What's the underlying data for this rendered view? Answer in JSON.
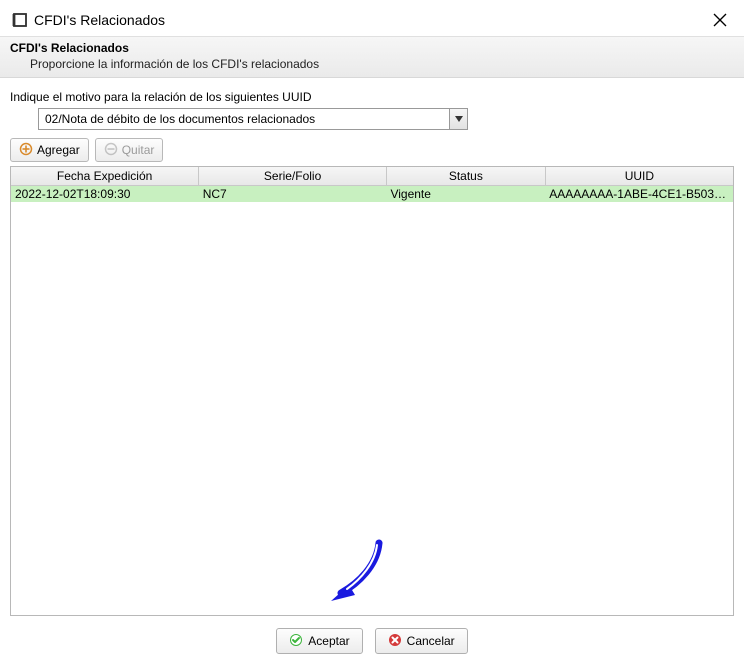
{
  "window": {
    "title": "CFDI's Relacionados"
  },
  "header": {
    "title": "CFDI's Relacionados",
    "subtitle": "Proporcione la información de los CFDI's relacionados"
  },
  "dropdown": {
    "label": "Indique el motivo para la relación de los siguientes UUID",
    "selected": "02/Nota de débito de los documentos relacionados"
  },
  "toolbar": {
    "add_label": "Agregar",
    "remove_label": "Quitar"
  },
  "table": {
    "columns": [
      "Fecha Expedición",
      "Serie/Folio",
      "Status",
      "UUID"
    ],
    "rows": [
      {
        "fecha": "2022-12-02T18:09:30",
        "serie": "NC7",
        "status": "Vigente",
        "uuid": "AAAAAAAA-1ABE-4CE1-B503-B..."
      }
    ]
  },
  "footer": {
    "accept_label": "Aceptar",
    "cancel_label": "Cancelar"
  }
}
